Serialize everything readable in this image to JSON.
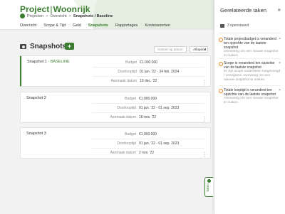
{
  "header": {
    "title_prefix": "Project",
    "title_name": "Woonrijk",
    "breadcrumb": [
      "Projecten",
      "Overzicht",
      "Snapshots / Baseline"
    ],
    "tabs": [
      "Overzicht",
      "Scope & Tijd",
      "Geld",
      "Snapshots",
      "Rapportages",
      "Kostensoorten"
    ],
    "active_tab": "Snapshots"
  },
  "main": {
    "section_title": "Snapshots",
    "add_label": "+",
    "sort_placeholder": "Sorteer op datum",
    "sort_value": "Aflopend"
  },
  "snapshots": [
    {
      "title": "Snapshot 1",
      "badge": "- BASELINE",
      "budget_label": "Budget",
      "budget": "€1.000.000",
      "doorloop_label": "Doorlooptijd",
      "doorloop": "01 jan. '22 - 24 feb. 2024",
      "aanmaak_label": "Aanmaak datum",
      "aanmaak": "10 dec. '22"
    },
    {
      "title": "Snapshot 2",
      "badge": "",
      "budget_label": "Budget",
      "budget": "€1.000.000",
      "doorloop_label": "Doorlooptijd",
      "doorloop": "01 jan. '22 - 01 sep. 2023",
      "aanmaak_label": "Aanmaak datum",
      "aanmaak": "16-nov. '22"
    },
    {
      "title": "Snapshot 3",
      "badge": "",
      "budget_label": "Budget",
      "budget": "€1.000.000",
      "doorloop_label": "Doorlooptijd",
      "doorloop": "01 jan. '22 - 01 sep. 2023",
      "aanmaak_label": "Aanmaak datum",
      "aanmaak": "2 nov. '22"
    }
  ],
  "panel": {
    "title": "Gerelateerde taken",
    "open_count": "3 openstaand",
    "tasks": [
      {
        "title": "Totale projectbudget is veranderd ten opzichte van de laatste snapshot",
        "desc": "Overweeg om een nieuwe snapshot te maken."
      },
      {
        "title": "Scope is veranderd ten opzichte van de laatste snapshot",
        "desc": "Er zijn scope onderdelen toegevoegd / verwijderd, overweeg om een nieuwe snapshot te maken."
      },
      {
        "title": "Totale looptijd is veranderd ten opzichte van de laatste snapshot",
        "desc": "Overweeg om een nieuwe snapshot te maken."
      }
    ],
    "tab_label": "Taken"
  },
  "colors": {
    "accent": "#3a7d2e",
    "warning": "#e08a1a"
  }
}
